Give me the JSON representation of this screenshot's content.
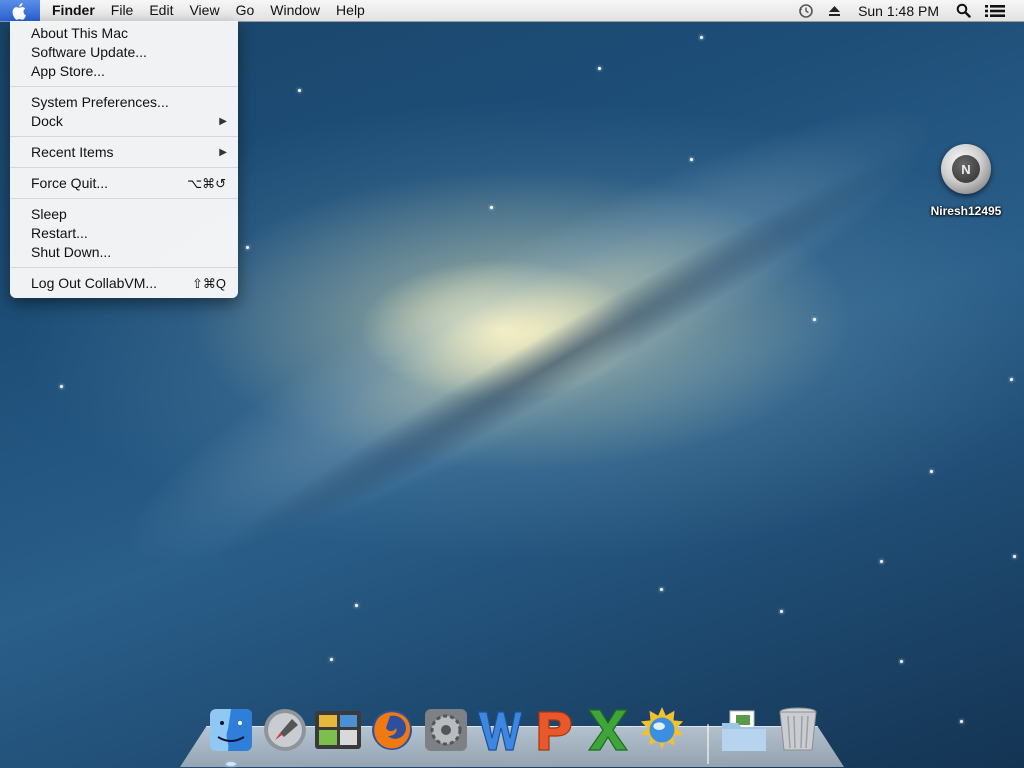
{
  "menubar": {
    "apple_icon": "apple-icon",
    "app_name": "Finder",
    "menus": [
      "File",
      "Edit",
      "View",
      "Go",
      "Window",
      "Help"
    ],
    "status_icons": [
      "time-machine-icon",
      "eject-icon"
    ],
    "clock": "Sun 1:48 PM",
    "right_icons": [
      "spotlight-search-icon",
      "notification-center-icon"
    ]
  },
  "apple_menu": {
    "groups": [
      [
        {
          "label": "About This Mac"
        },
        {
          "label": "Software Update..."
        },
        {
          "label": "App Store..."
        }
      ],
      [
        {
          "label": "System Preferences..."
        },
        {
          "label": "Dock",
          "submenu": true
        }
      ],
      [
        {
          "label": "Recent Items",
          "submenu": true
        }
      ],
      [
        {
          "label": "Force Quit...",
          "shortcut": "⌥⌘↺"
        }
      ],
      [
        {
          "label": "Sleep"
        },
        {
          "label": "Restart..."
        },
        {
          "label": "Shut Down..."
        }
      ],
      [
        {
          "label": "Log Out CollabVM...",
          "shortcut": "⇧⌘Q"
        }
      ]
    ]
  },
  "desktop_icon": {
    "label": "Niresh12495",
    "glyph": "N",
    "icon": "disk-icon"
  },
  "dock": {
    "apps": [
      {
        "name": "Finder",
        "icon": "finder-icon",
        "running": true
      },
      {
        "name": "Launchpad",
        "icon": "launchpad-icon"
      },
      {
        "name": "Photo Browser",
        "icon": "photo-browser-icon"
      },
      {
        "name": "Firefox",
        "icon": "firefox-icon"
      },
      {
        "name": "System Preferences",
        "icon": "system-preferences-icon"
      },
      {
        "name": "Word",
        "icon": "word-icon"
      },
      {
        "name": "PowerPoint",
        "icon": "powerpoint-icon"
      },
      {
        "name": "Excel",
        "icon": "excel-icon"
      },
      {
        "name": "Network Utility",
        "icon": "network-globe-icon"
      }
    ],
    "stacks": [
      {
        "name": "Documents",
        "icon": "documents-folder-icon"
      },
      {
        "name": "Trash",
        "icon": "trash-icon"
      }
    ]
  },
  "colors": {
    "menubar_bg": "#e9e9e9",
    "apple_highlight": "#3b73da",
    "desktop_bg": "#1d4e78"
  }
}
